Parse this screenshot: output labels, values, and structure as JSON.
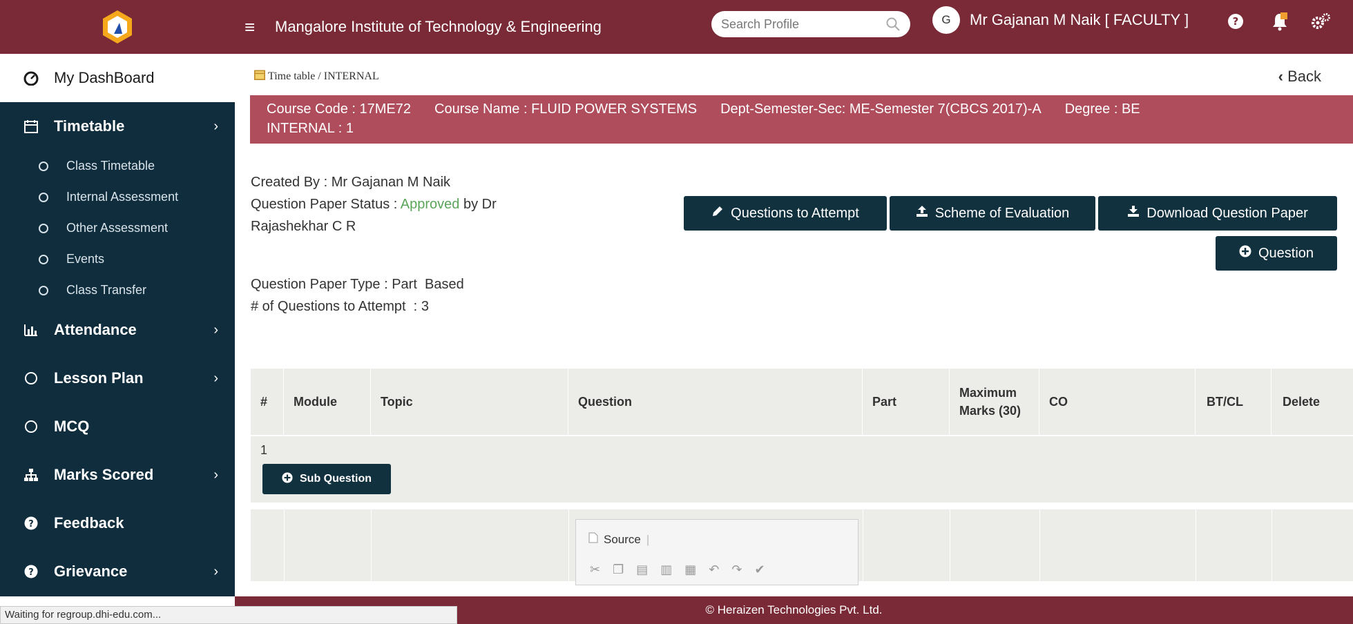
{
  "header": {
    "org_title": "Mangalore Institute of Technology & Engineering",
    "search_placeholder": "Search Profile",
    "user_initial": "G",
    "user_name": "Mr Gajanan M Naik [ FACULTY ]"
  },
  "sidebar": {
    "dashboard": "My DashBoard",
    "timetable": "Timetable",
    "sub_items": [
      "Class Timetable",
      "Internal Assessment",
      "Other Assessment",
      "Events",
      "Class Transfer"
    ],
    "attendance": "Attendance",
    "lesson_plan": "Lesson Plan",
    "mcq": "MCQ",
    "marks_scored": "Marks Scored",
    "feedback": "Feedback",
    "grievance": "Grievance"
  },
  "breadcrumb": {
    "section": "Time table",
    "current": "INTERNAL"
  },
  "back_label": "Back",
  "course": {
    "code": "Course Code : 17ME72",
    "name": "Course Name : FLUID POWER SYSTEMS",
    "dept": "Dept-Semester-Sec: ME-Semester 7(CBCS 2017)-A",
    "degree": "Degree : BE",
    "internal": "INTERNAL : 1"
  },
  "meta": {
    "created_by_label": "Created By :",
    "created_by": "Mr Gajanan M Naik",
    "status_label": "Question Paper Status :",
    "status": "Approved",
    "approved_by_prefix": "by Dr",
    "approved_by": "Rajashekhar C R",
    "type_label": "Question Paper Type :",
    "type": "Part  Based",
    "attempt_label": "# of Questions to Attempt  :",
    "attempt": "3"
  },
  "buttons": {
    "questions_to_attempt": "Questions to Attempt",
    "scheme_of_evaluation": "Scheme of Evaluation",
    "download_question_paper": "Download Question Paper",
    "question": "Question",
    "sub_question": "Sub Question"
  },
  "table": {
    "headers": {
      "num": "#",
      "module": "Module",
      "topic": "Topic",
      "question": "Question",
      "part": "Part",
      "max_marks_1": "Maximum",
      "max_marks_2": "Marks (30)",
      "co": "CO",
      "bt": "BT/CL",
      "delete": "Delete"
    },
    "row_number": "1",
    "editor_source": "Source"
  },
  "footer": "© Heraizen Technologies Pvt. Ltd.",
  "status_bar": "Waiting for regroup.dhi-edu.com...",
  "colors": {
    "brand": "#7a2a36",
    "band": "#b04d5c",
    "sidebar": "#0f2d3d",
    "button": "#11313f",
    "approved": "#5aa55a"
  }
}
